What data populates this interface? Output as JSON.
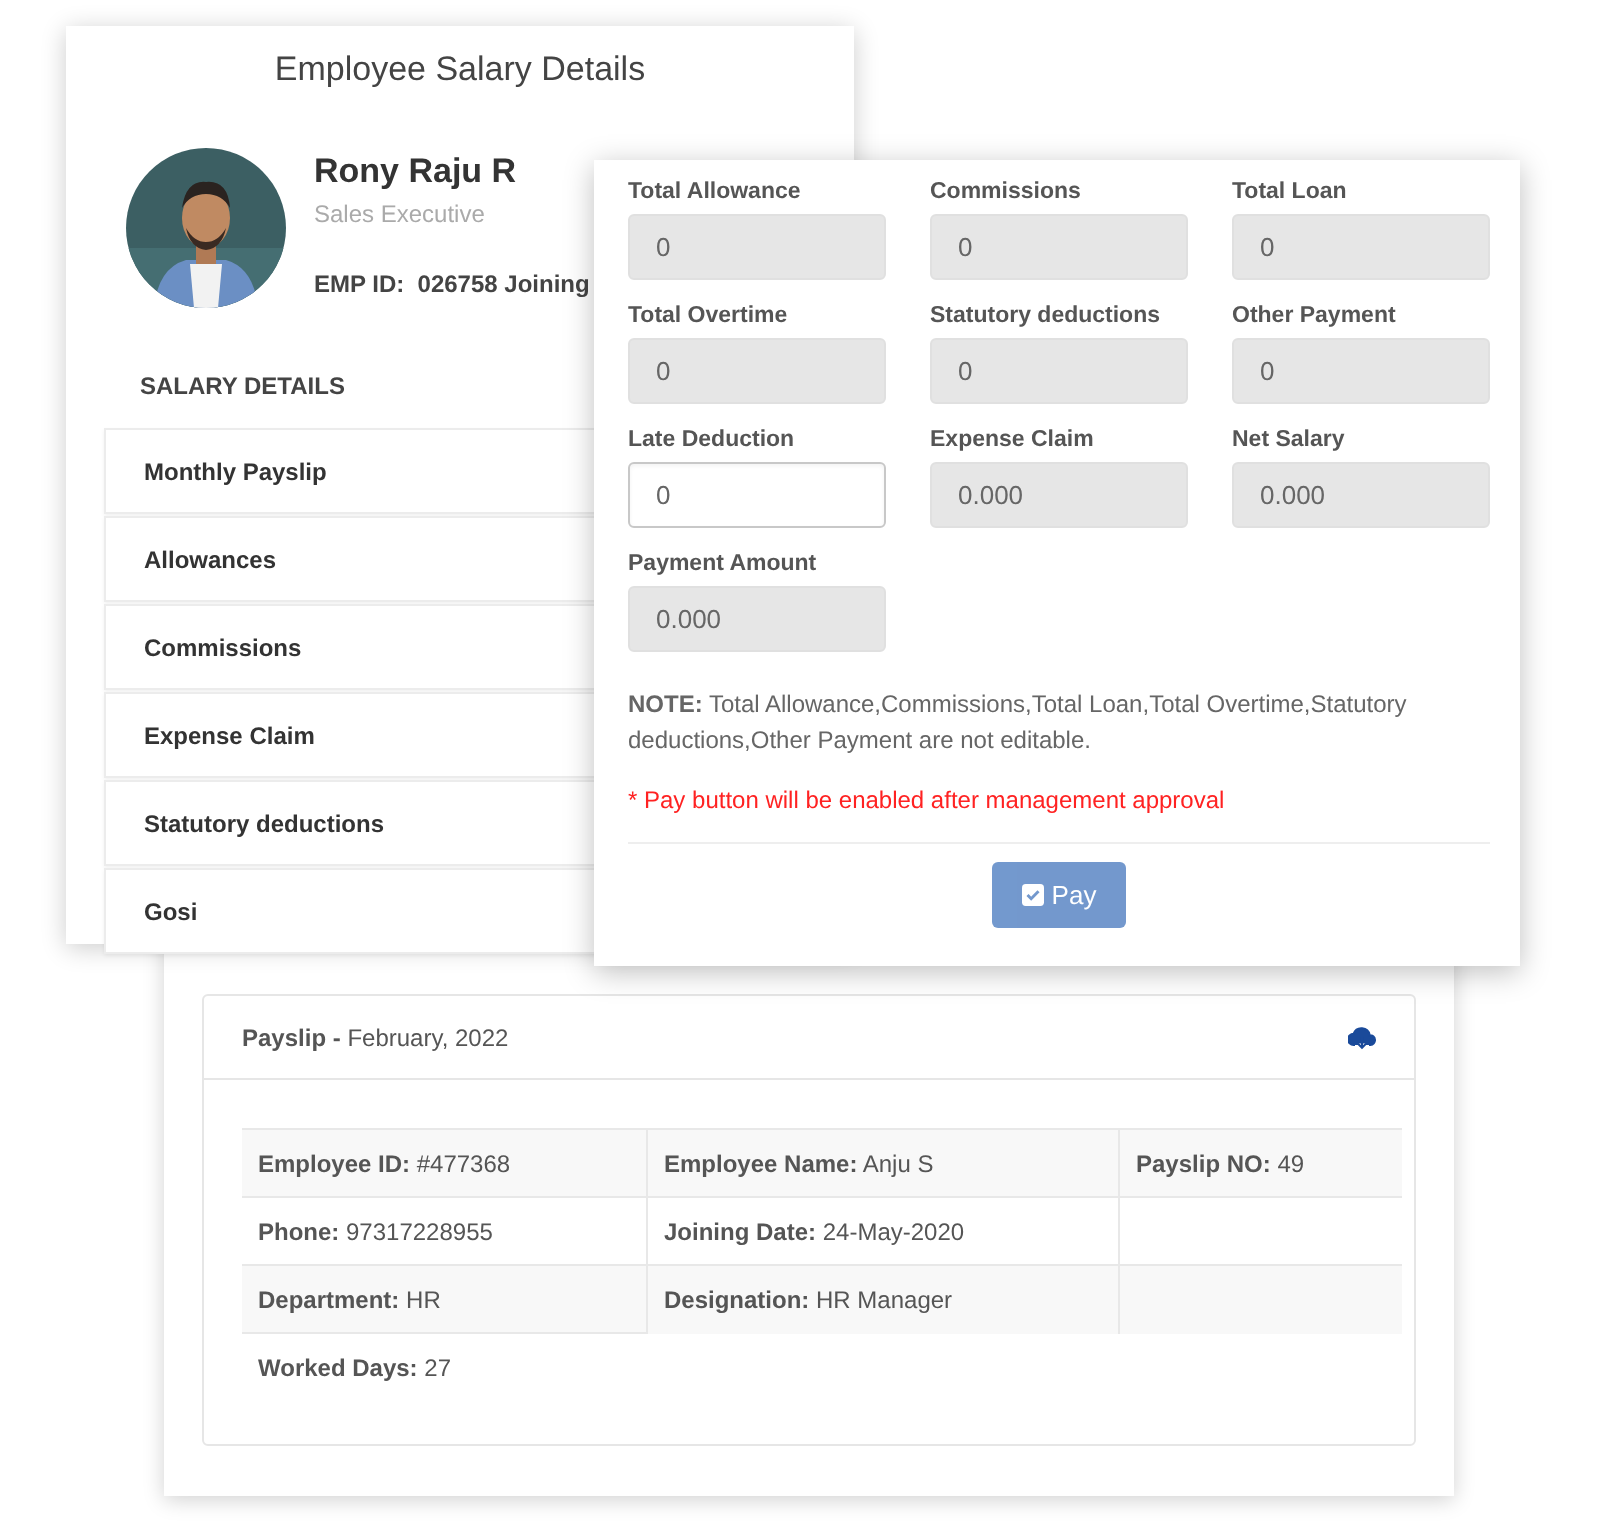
{
  "payslip_panel": {
    "header": "**Payslip -** February, 2022",
    "rows": [
      [
        "**Employee ID:** #477368",
        "**Employee Name:** Anju S",
        "**Payslip NO:** 49"
      ],
      [
        "**Phone:** 97317228955",
        "**Joining Date:** 24-May-2020"
      ],
      [
        "**Department:** HR",
        "**Designation:** HR Manager"
      ],
      [
        "**Worked Days:** 27"
      ]
    ]
  },
  "salary_panel": {
    "title": "Employee Salary Details",
    "employee": {
      "name": "Rony Raju R",
      "role": "Sales Executive",
      "id_line": "EMP ID:  026758 Joining"
    },
    "section_title": "SALARY DETAILS",
    "items": [
      "Monthly Payslip",
      "Allowances",
      "Commissions",
      "Expense Claim",
      "Statutory deductions",
      "Gosi"
    ]
  },
  "payment_form": {
    "fields": [
      {
        "label": "Total Allowance",
        "value": "0",
        "editable": false
      },
      {
        "label": "Commissions",
        "value": "0",
        "editable": false
      },
      {
        "label": "Total Loan",
        "value": "0",
        "editable": false
      },
      {
        "label": "Total Overtime",
        "value": "0",
        "editable": false
      },
      {
        "label": "Statutory deductions",
        "value": "0",
        "editable": false
      },
      {
        "label": "Other Payment",
        "value": "0",
        "editable": false
      },
      {
        "label": "Late Deduction",
        "value": "0",
        "editable": true
      },
      {
        "label": "Expense Claim",
        "value": "0.000",
        "editable": false
      },
      {
        "label": "Net Salary",
        "value": "0.000",
        "editable": false
      },
      {
        "label": "Payment Amount",
        "value": "0.000",
        "editable": false
      }
    ],
    "note": "**NOTE:** Total Allowance,Commissions,Total Loan,Total Overtime,Statutory deductions,Other Payment are not editable.",
    "warning": "* Pay button will be enabled after management approval",
    "pay_button": {
      "label": "Pay",
      "disabled": true
    }
  }
}
